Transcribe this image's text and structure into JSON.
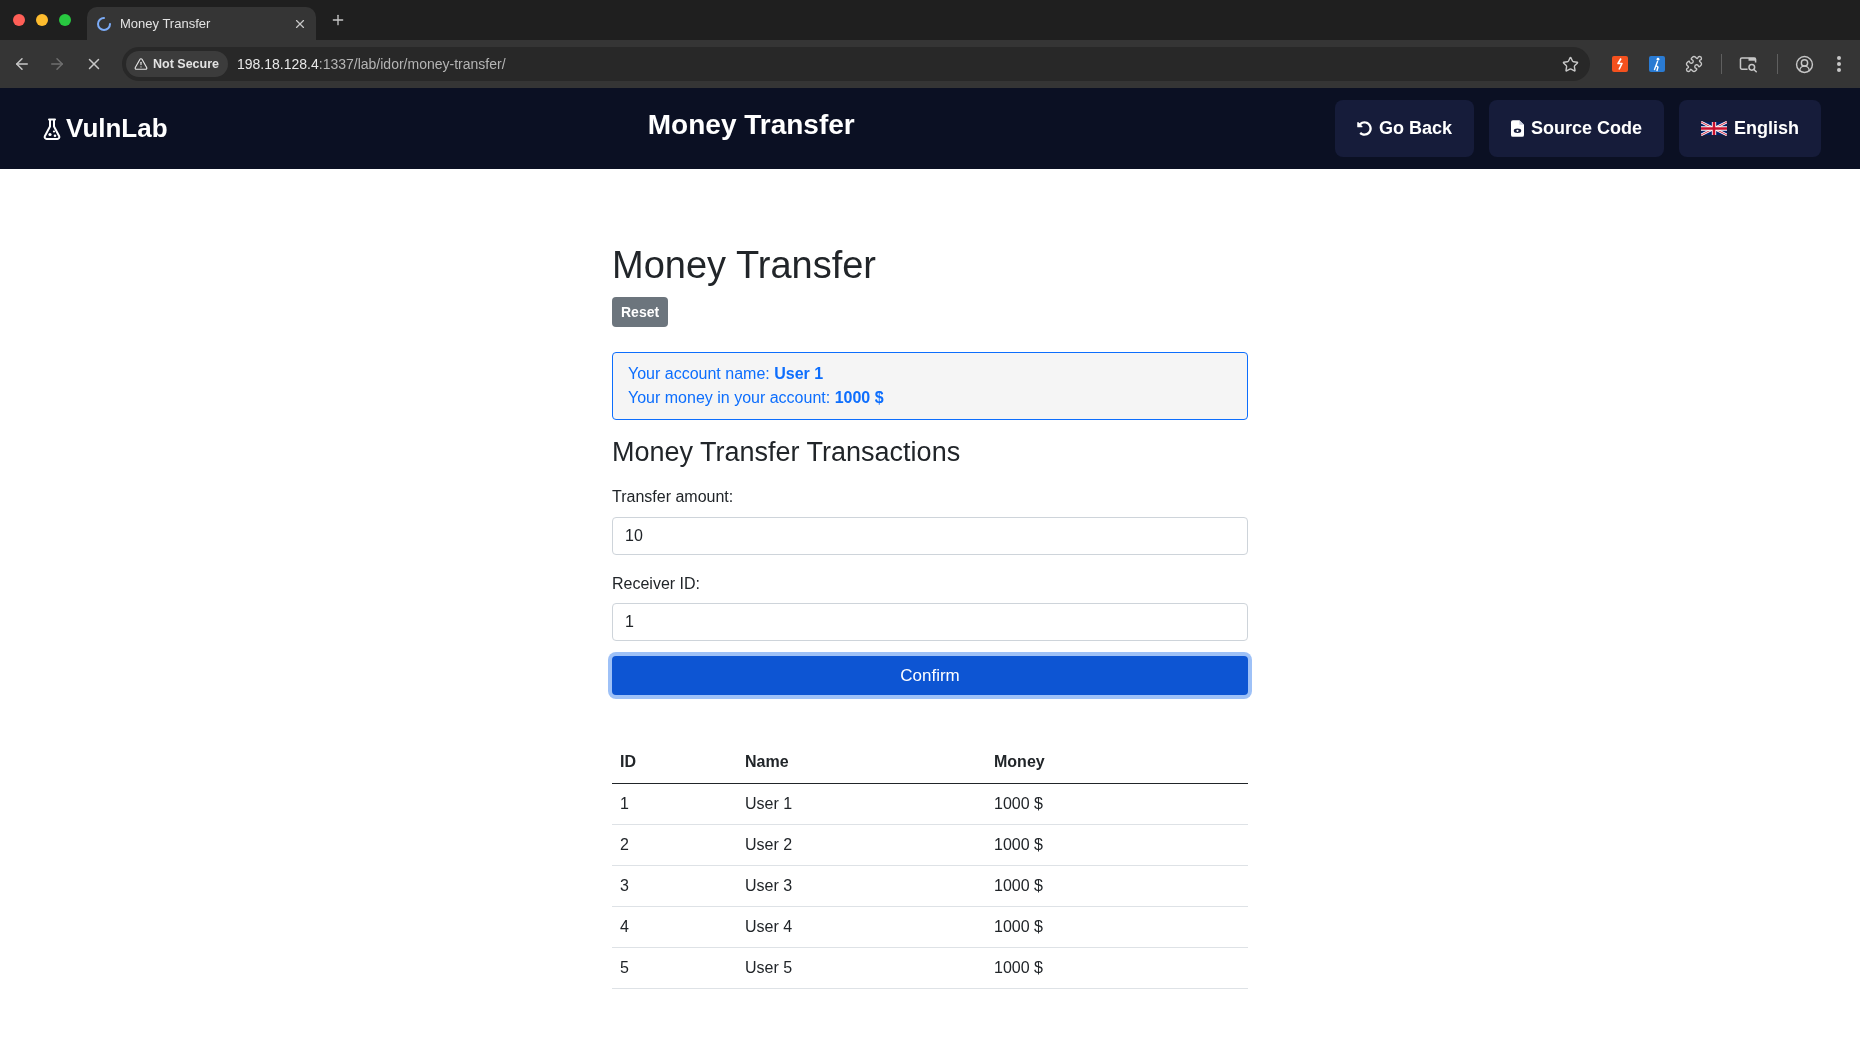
{
  "browser": {
    "loading": true,
    "tab": {
      "title": "Money Transfer"
    },
    "navigation": {
      "back": {
        "disabled": false
      },
      "forward": {
        "disabled": true
      }
    },
    "address_bar": {
      "security_label": "Not Secure",
      "host": "198.18.128.4",
      "path": ":1337/lab/idor/money-transfer/"
    }
  },
  "header": {
    "logo": "VulnLab",
    "title": "Money Transfer",
    "buttons": [
      {
        "kind": "back",
        "label": "Go Back"
      },
      {
        "kind": "source",
        "label": "Source Code"
      },
      {
        "kind": "language",
        "label": "English"
      }
    ]
  },
  "main": {
    "title": "Money Transfer",
    "reset_button": "Reset",
    "account_info": [
      "Your account name: **User 1**",
      "Your money in your account: **1000 $**"
    ],
    "section_title": "Money Transfer Transactions",
    "fields": [
      {
        "label": "Transfer amount:",
        "value": "10"
      },
      {
        "label": "Receiver ID:",
        "value": "1"
      }
    ],
    "confirm_button": {
      "label": "Confirm",
      "focused": true
    }
  },
  "table": {
    "columns": [
      "ID",
      "Name",
      "Money"
    ],
    "rows": [
      [
        "1",
        "User 1",
        "1000 $"
      ],
      [
        "2",
        "User 2",
        "1000 $"
      ],
      [
        "3",
        "User 3",
        "1000 $"
      ],
      [
        "4",
        "User 4",
        "1000 $"
      ],
      [
        "5",
        "User 5",
        "1000 $"
      ]
    ]
  }
}
